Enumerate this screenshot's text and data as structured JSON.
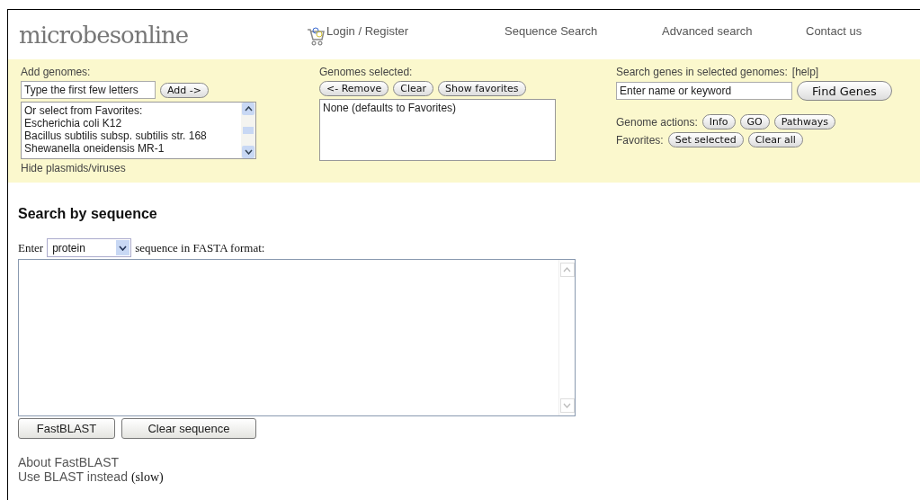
{
  "logo": "microbesonline",
  "nav": [
    "Login / Register",
    "Sequence Search",
    "Advanced search",
    "Contact us"
  ],
  "add_genomes": {
    "label": "Add genomes:",
    "placeholder": "Type the first few letters",
    "button": "Add ->",
    "favorites": [
      "Or select from Favorites:",
      "Escherichia coli K12",
      "Bacillus subtilis subsp. subtilis str. 168",
      "Shewanella oneidensis MR-1"
    ],
    "link": "Hide plasmids/viruses"
  },
  "genomes_selected": {
    "label": "Genomes selected:",
    "buttons": [
      "<- Remove",
      "Clear",
      "Show favorites"
    ],
    "items": [
      "None (defaults to Favorites)"
    ]
  },
  "gene_search": {
    "label": "Search genes in selected genomes:",
    "help": "[help]",
    "placeholder": "Enter name or keyword",
    "button": "Find Genes",
    "actions_label": "Genome actions:",
    "actions": [
      "Info",
      "GO",
      "Pathways"
    ],
    "favorites_label": "Favorites:",
    "favorites_buttons": [
      "Set selected",
      "Clear all"
    ]
  },
  "sequence": {
    "title": "Search by sequence",
    "prefix": "Enter",
    "type": "protein",
    "suffix": "sequence in FASTA format:",
    "buttons": [
      "FastBLAST",
      "Clear sequence"
    ],
    "about_link": "About FastBLAST",
    "blast_link": "Use BLAST instead",
    "blast_note": "(slow)"
  }
}
